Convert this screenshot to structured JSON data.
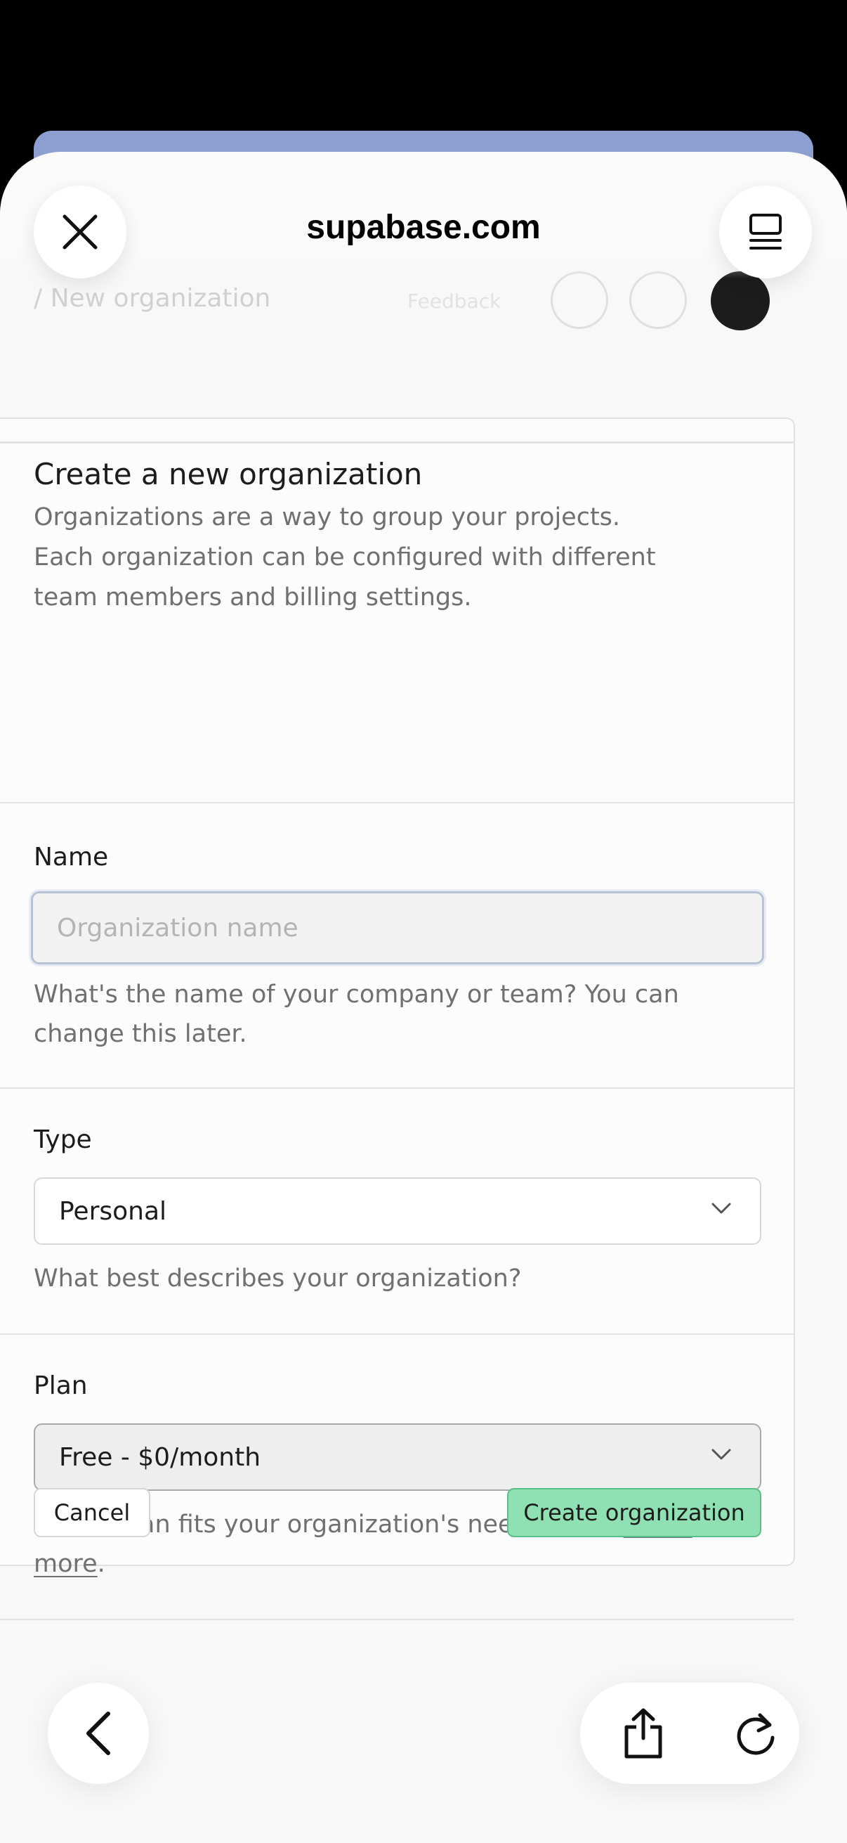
{
  "browser": {
    "site_title": "supabase.com",
    "close_icon": "close-icon",
    "tabs_icon": "tabs-overview-icon"
  },
  "ghost_nav": {
    "breadcrumb": "/ New organization",
    "feedback": "Feedback"
  },
  "card": {
    "title": "Create a new organization",
    "description": "Organizations are a way to group your projects. Each organization can be configured with different team members and billing settings."
  },
  "name_field": {
    "label": "Name",
    "placeholder": "Organization name",
    "value": "",
    "help": "What's the name of your company or team? You can change this later."
  },
  "type_field": {
    "label": "Type",
    "selected": "Personal",
    "help": "What best describes your organization?"
  },
  "plan_field": {
    "label": "Plan",
    "selected": "Free - $0/month",
    "help_prefix": "Which plan fits your organization's needs best? ",
    "help_link": "Learn more",
    "help_suffix": "."
  },
  "actions": {
    "cancel": "Cancel",
    "create": "Create organization"
  },
  "colors": {
    "create_button": "#8fe0b2",
    "create_border": "#5bbf8a",
    "background_tab": "#8c9fd0"
  },
  "toolbar": {
    "back_icon": "chevron-left-icon",
    "share_icon": "share-icon",
    "reload_icon": "reload-icon"
  }
}
